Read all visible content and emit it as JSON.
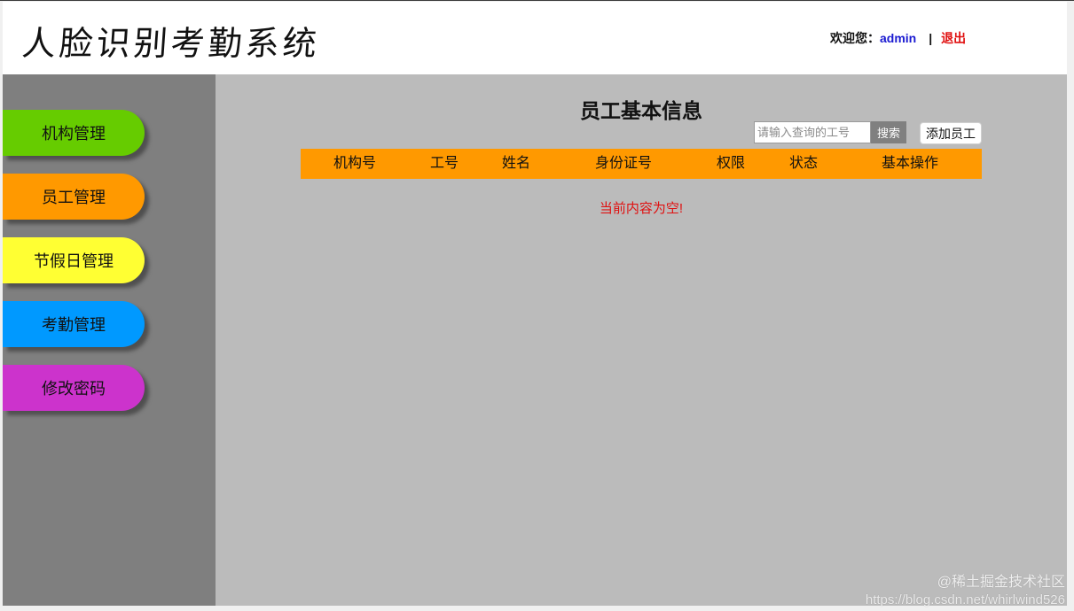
{
  "header": {
    "logo_text": "人脸识别考勤系统",
    "welcome_label": "欢迎您：",
    "username": "admin",
    "separator": "|",
    "logout_label": "退出"
  },
  "sidebar": {
    "items": [
      {
        "label": "机构管理",
        "color": "#66cc00"
      },
      {
        "label": "员工管理",
        "color": "#ff9900"
      },
      {
        "label": "节假日管理",
        "color": "#ffff33"
      },
      {
        "label": "考勤管理",
        "color": "#0099ff"
      },
      {
        "label": "修改密码",
        "color": "#cc33cc"
      }
    ]
  },
  "main": {
    "title": "员工基本信息",
    "search": {
      "placeholder": "请输入查询的工号",
      "value": "",
      "button_label": "搜索"
    },
    "add_button_label": "添加员工",
    "table": {
      "header_color": "#ff9900",
      "columns": [
        "机构号",
        "工号",
        "姓名",
        "身份证号",
        "权限",
        "状态",
        "基本操作"
      ],
      "rows": []
    },
    "empty_message": "当前内容为空!"
  },
  "watermark": {
    "line1": "@稀土掘金技术社区",
    "line2": "https://blog.csdn.net/whirlwind526"
  }
}
